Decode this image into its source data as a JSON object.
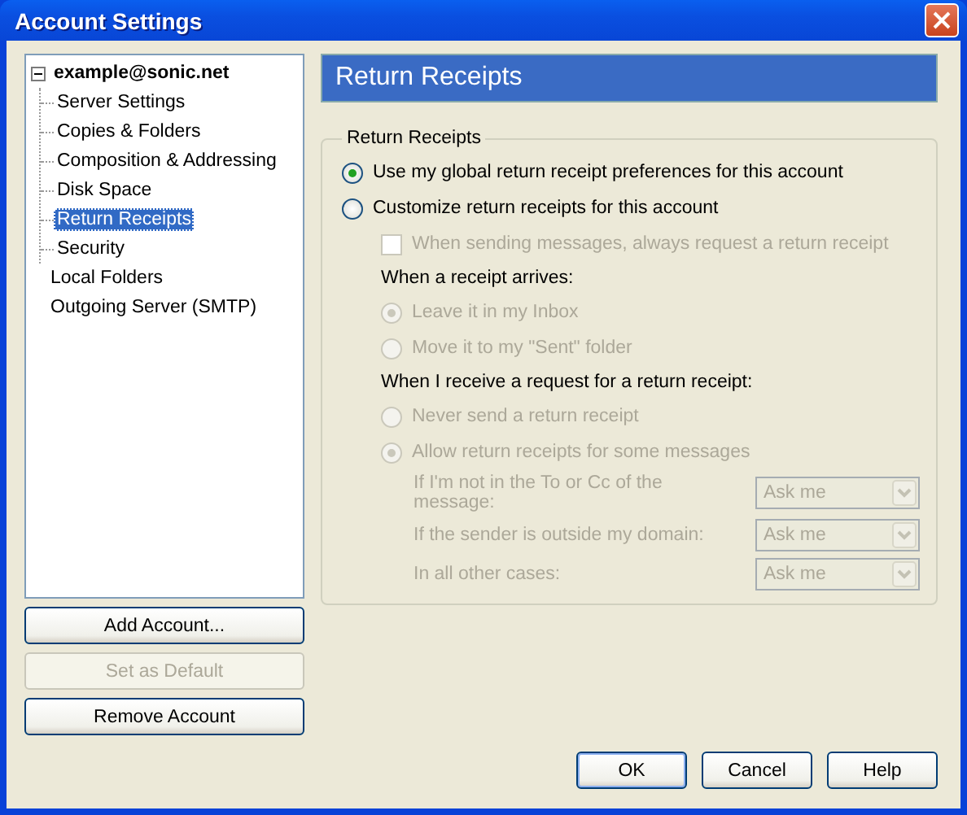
{
  "window": {
    "title": "Account Settings"
  },
  "tree": [
    {
      "label": "example@sonic.net",
      "expanded": true,
      "selected": false,
      "children": [
        {
          "label": "Server Settings",
          "selected": false
        },
        {
          "label": "Copies & Folders",
          "selected": false
        },
        {
          "label": "Composition & Addressing",
          "selected": false
        },
        {
          "label": "Disk Space",
          "selected": false
        },
        {
          "label": "Return Receipts",
          "selected": true
        },
        {
          "label": "Security",
          "selected": false
        }
      ]
    },
    {
      "label": "Local Folders",
      "selected": false
    },
    {
      "label": "Outgoing Server (SMTP)",
      "selected": false
    }
  ],
  "account_buttons": [
    {
      "label": "Add Account...",
      "disabled": false
    },
    {
      "label": "Set as Default",
      "disabled": true
    },
    {
      "label": "Remove Account",
      "disabled": false
    }
  ],
  "panel": {
    "title": "Return Receipts",
    "legend": "Return Receipts",
    "mode_options": [
      {
        "label": "Use my global return receipt preferences for this account",
        "selected": true
      },
      {
        "label": "Customize return receipts for this account",
        "selected": false
      }
    ],
    "custom": {
      "disabled": true,
      "request_checkbox": {
        "label": "When sending messages, always request a return receipt",
        "checked": false
      },
      "arrival": {
        "heading": "When a receipt arrives:",
        "options": [
          {
            "label": "Leave it in my Inbox",
            "selected": true
          },
          {
            "label": "Move it to my \"Sent\" folder",
            "selected": false
          }
        ]
      },
      "requests": {
        "heading": "When I receive a request for a return receipt:",
        "options": [
          {
            "label": "Never send a return receipt",
            "selected": false
          },
          {
            "label": "Allow return receipts for some messages",
            "selected": true
          }
        ],
        "rules": [
          {
            "label": "If I'm not in the To or Cc of the message:",
            "value": "Ask me"
          },
          {
            "label": "If the sender is outside my domain:",
            "value": "Ask me"
          },
          {
            "label": "In all other cases:",
            "value": "Ask me"
          }
        ]
      }
    }
  },
  "dialog_buttons": [
    {
      "label": "OK",
      "default": true
    },
    {
      "label": "Cancel",
      "default": false
    },
    {
      "label": "Help",
      "default": false
    }
  ]
}
